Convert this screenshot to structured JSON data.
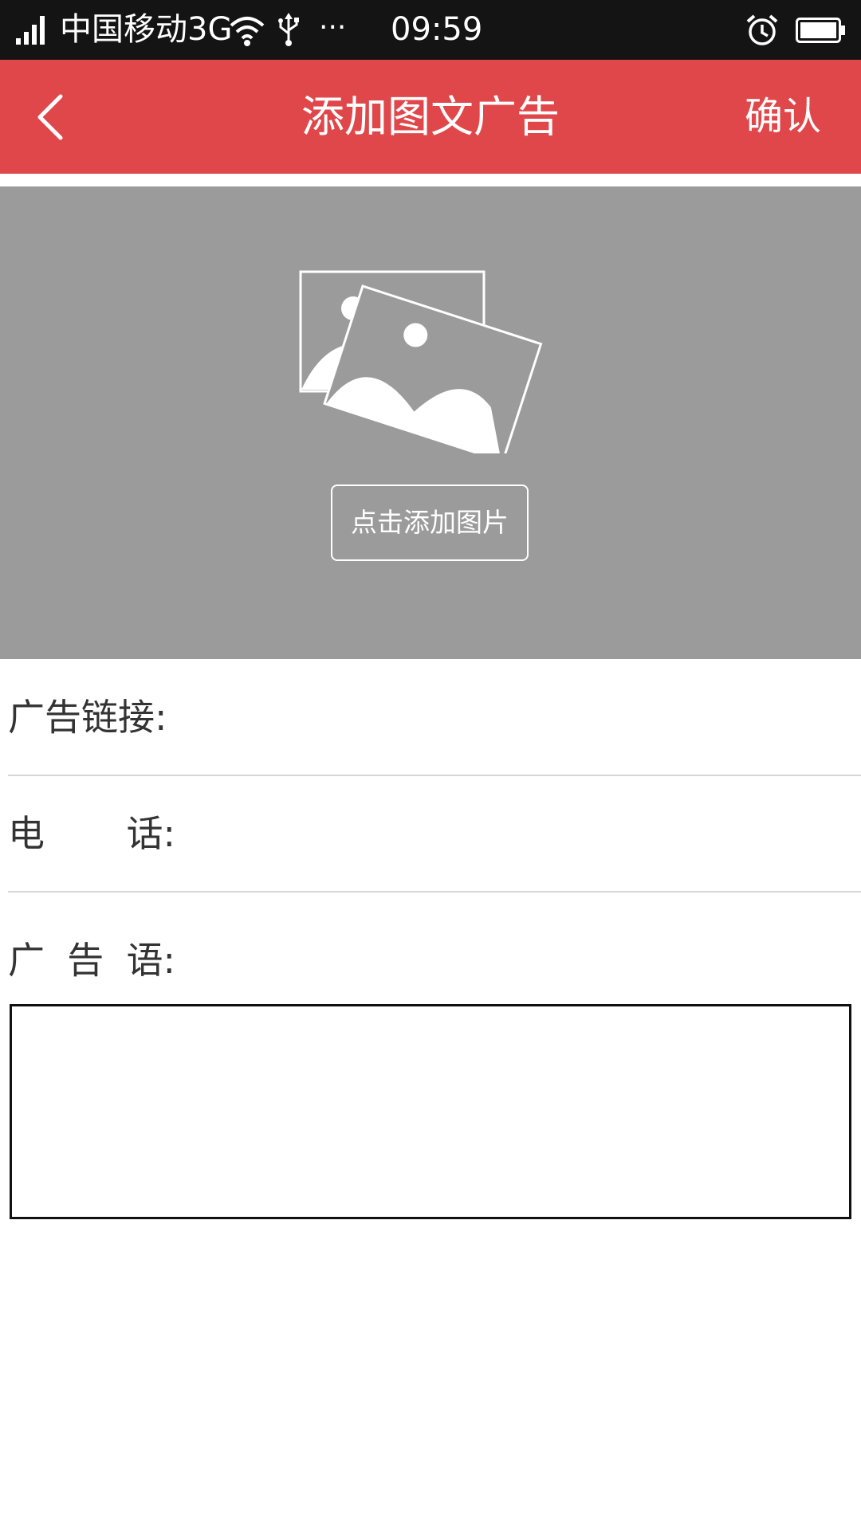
{
  "status_bar": {
    "carrier": "中国移动3G",
    "more": "···",
    "time": "09:59",
    "icons": [
      "signal-icon",
      "wifi-icon",
      "usb-icon",
      "alarm-icon",
      "battery-icon"
    ]
  },
  "header": {
    "title": "添加图文广告",
    "confirm_label": "确认",
    "back_icon": "chevron-left-icon",
    "background_color": "#e0474a"
  },
  "image_area": {
    "placeholder_icon": "image-placeholder-icon",
    "add_button_label": "点击添加图片",
    "background_color": "#9b9b9b"
  },
  "form": {
    "ad_link": {
      "label": "广告链接:",
      "value": ""
    },
    "phone": {
      "label_chars": [
        "电",
        "话:"
      ],
      "value": ""
    },
    "slogan": {
      "label_chars": [
        "广",
        "告",
        "语:"
      ],
      "value": ""
    }
  }
}
